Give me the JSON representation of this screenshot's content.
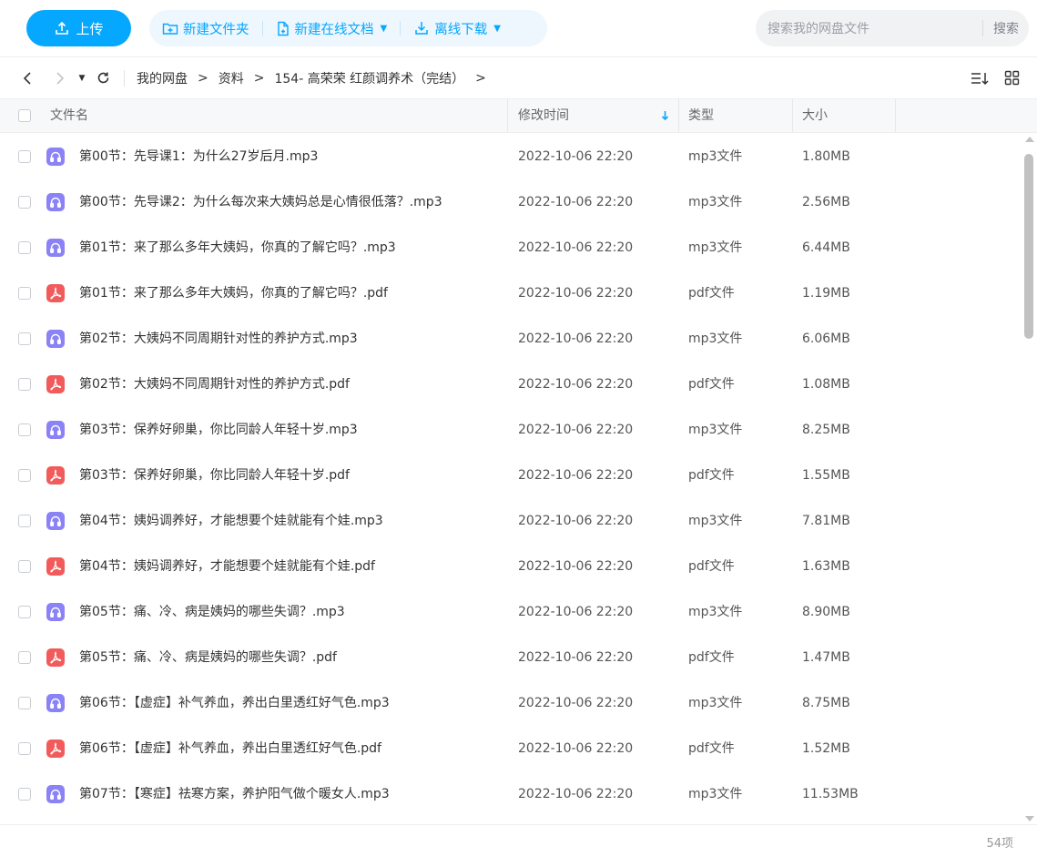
{
  "toolbar": {
    "upload_label": "上传",
    "new_folder_label": "新建文件夹",
    "new_doc_label": "新建在线文档",
    "offline_download_label": "离线下载",
    "search_placeholder": "搜索我的网盘文件",
    "search_button_label": "搜索"
  },
  "breadcrumb": [
    "我的网盘",
    "资料",
    "154- 高荣荣 红颜调养术（完结）"
  ],
  "breadcrumb_sep": ">",
  "columns": {
    "name": "文件名",
    "modified": "修改时间",
    "type": "类型",
    "size": "大小"
  },
  "files": [
    {
      "name": "第00节：先导课1：为什么27岁后月.mp3",
      "date": "2022-10-06 22:20",
      "type": "mp3文件",
      "size": "1.80MB",
      "icon": "audio-file-icon"
    },
    {
      "name": "第00节：先导课2：为什么每次来大姨妈总是心情很低落？.mp3",
      "date": "2022-10-06 22:20",
      "type": "mp3文件",
      "size": "2.56MB",
      "icon": "audio-file-icon"
    },
    {
      "name": "第01节：来了那么多年大姨妈，你真的了解它吗？.mp3",
      "date": "2022-10-06 22:20",
      "type": "mp3文件",
      "size": "6.44MB",
      "icon": "audio-file-icon"
    },
    {
      "name": "第01节：来了那么多年大姨妈，你真的了解它吗？.pdf",
      "date": "2022-10-06 22:20",
      "type": "pdf文件",
      "size": "1.19MB",
      "icon": "pdf-file-icon"
    },
    {
      "name": "第02节：大姨妈不同周期针对性的养护方式.mp3",
      "date": "2022-10-06 22:20",
      "type": "mp3文件",
      "size": "6.06MB",
      "icon": "audio-file-icon"
    },
    {
      "name": "第02节：大姨妈不同周期针对性的养护方式.pdf",
      "date": "2022-10-06 22:20",
      "type": "pdf文件",
      "size": "1.08MB",
      "icon": "pdf-file-icon"
    },
    {
      "name": "第03节：保养好卵巢，你比同龄人年轻十岁.mp3",
      "date": "2022-10-06 22:20",
      "type": "mp3文件",
      "size": "8.25MB",
      "icon": "audio-file-icon"
    },
    {
      "name": "第03节：保养好卵巢，你比同龄人年轻十岁.pdf",
      "date": "2022-10-06 22:20",
      "type": "pdf文件",
      "size": "1.55MB",
      "icon": "pdf-file-icon"
    },
    {
      "name": "第04节：姨妈调养好，才能想要个娃就能有个娃.mp3",
      "date": "2022-10-06 22:20",
      "type": "mp3文件",
      "size": "7.81MB",
      "icon": "audio-file-icon"
    },
    {
      "name": "第04节：姨妈调养好，才能想要个娃就能有个娃.pdf",
      "date": "2022-10-06 22:20",
      "type": "pdf文件",
      "size": "1.63MB",
      "icon": "pdf-file-icon"
    },
    {
      "name": "第05节：痛、冷、病是姨妈的哪些失调？.mp3",
      "date": "2022-10-06 22:20",
      "type": "mp3文件",
      "size": "8.90MB",
      "icon": "audio-file-icon"
    },
    {
      "name": "第05节：痛、冷、病是姨妈的哪些失调？.pdf",
      "date": "2022-10-06 22:20",
      "type": "pdf文件",
      "size": "1.47MB",
      "icon": "pdf-file-icon"
    },
    {
      "name": "第06节：【虚症】补气养血，养出白里透红好气色.mp3",
      "date": "2022-10-06 22:20",
      "type": "mp3文件",
      "size": "8.75MB",
      "icon": "audio-file-icon"
    },
    {
      "name": "第06节：【虚症】补气养血，养出白里透红好气色.pdf",
      "date": "2022-10-06 22:20",
      "type": "pdf文件",
      "size": "1.52MB",
      "icon": "pdf-file-icon"
    },
    {
      "name": "第07节：【寒症】祛寒方案，养护阳气做个暖女人.mp3",
      "date": "2022-10-06 22:20",
      "type": "mp3文件",
      "size": "11.53MB",
      "icon": "audio-file-icon"
    }
  ],
  "item_count": "54项",
  "colors": {
    "accent": "#06a7ff",
    "toolbar_group_bg": "#eef7fe",
    "audio_icon": "#8a82f5",
    "pdf_icon": "#f25b5b"
  }
}
